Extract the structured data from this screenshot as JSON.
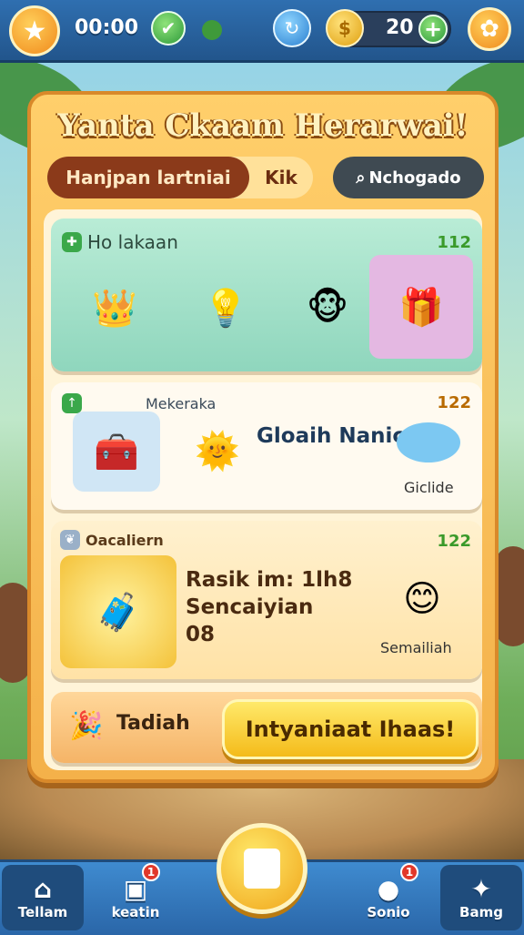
{
  "topbar": {
    "time": "00:00",
    "coins": "20",
    "icons": [
      "star-icon",
      "check-icon",
      "dot-icon",
      "blue-action-icon",
      "coin-icon",
      "plus-icon",
      "gear-icon"
    ]
  },
  "panel": {
    "title": "Yanta Ckaam Herarwai!",
    "tab_active": "Hanjpan lartniai",
    "tab_second": "Kik",
    "search_label": "Nchogado"
  },
  "card1": {
    "header": "Ho lakaan",
    "count": "112"
  },
  "card2": {
    "header": "Mekeraka",
    "count": "122",
    "title": "Gloaih Nanican",
    "side_label": "Giclide"
  },
  "card3": {
    "header": "Oacaliern",
    "count": "122",
    "line1": "Rasik im: 1lh8",
    "line2": "Sencaiyian",
    "line3": "08",
    "side_label": "Semailiah"
  },
  "card4": {
    "label": "Tadiah",
    "cta": "Intyaniaat Ihaas!"
  },
  "bottom_nav": {
    "items": [
      {
        "label": "Tellam",
        "icon": "home-icon"
      },
      {
        "label": "keatin",
        "icon": "box-icon",
        "badge": "1"
      },
      {
        "label": "Sonio",
        "icon": "pouch-icon",
        "badge": "1"
      },
      {
        "label": "Bamg",
        "icon": "star-shield-icon"
      }
    ]
  },
  "colors": {
    "accent": "#f4b14a",
    "nav": "#2a66a8",
    "cta": "#f4bb1a"
  }
}
